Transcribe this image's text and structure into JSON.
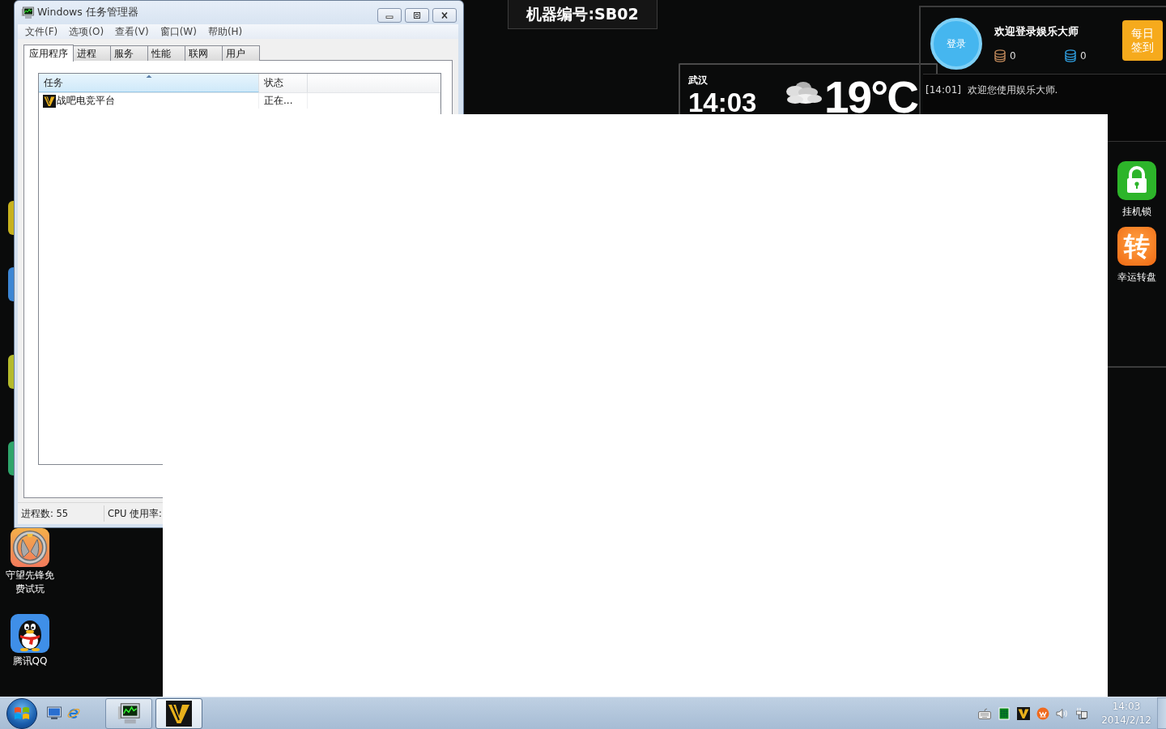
{
  "task_manager": {
    "title": "Windows 任务管理器",
    "menu": [
      "文件(F)",
      "选项(O)",
      "查看(V)",
      "窗口(W)",
      "帮助(H)"
    ],
    "tabs": [
      {
        "label": "应用程序",
        "selected": true
      },
      {
        "label": "进程",
        "selected": false
      },
      {
        "label": "服务",
        "selected": false
      },
      {
        "label": "性能",
        "selected": false
      },
      {
        "label": "联网",
        "selected": false
      },
      {
        "label": "用户",
        "selected": false
      }
    ],
    "columns": [
      {
        "label": "任务",
        "sorted": true
      },
      {
        "label": "状态",
        "sorted": false
      }
    ],
    "rows": [
      {
        "task": "战吧电竞平台",
        "status": "正在..."
      }
    ],
    "status_bar": [
      "进程数: 55",
      "CPU 使用率:"
    ]
  },
  "machine_label": "机器编号:SB02",
  "weather": {
    "city": "武汉",
    "time": "14:03",
    "temperature": "19°C"
  },
  "member_panel": {
    "login_button": "登录",
    "welcome": "欢迎登录娱乐大师",
    "balances": [
      {
        "value": "0",
        "color": "#c0895a"
      },
      {
        "value": "0",
        "color": "#2f9fe0"
      }
    ],
    "checkin_button": "每日签到",
    "messages": [
      "[14:01]  欢迎您使用娱乐大师."
    ]
  },
  "side_apps": [
    {
      "kind": "lock",
      "label": "挂机锁"
    },
    {
      "kind": "wheel",
      "glyph": "转",
      "label": "幸运转盘"
    }
  ],
  "desktop_icons": [
    {
      "kind": "overwatch",
      "label": "守望先锋免费试玩"
    },
    {
      "kind": "qq",
      "label": "腾讯QQ"
    }
  ],
  "taskbar": {
    "tasks": [
      {
        "kind": "monitor",
        "selected": false
      },
      {
        "kind": "v-logo",
        "selected": true
      }
    ],
    "clock": {
      "time": "14:03",
      "date": "2014/2/12"
    }
  }
}
